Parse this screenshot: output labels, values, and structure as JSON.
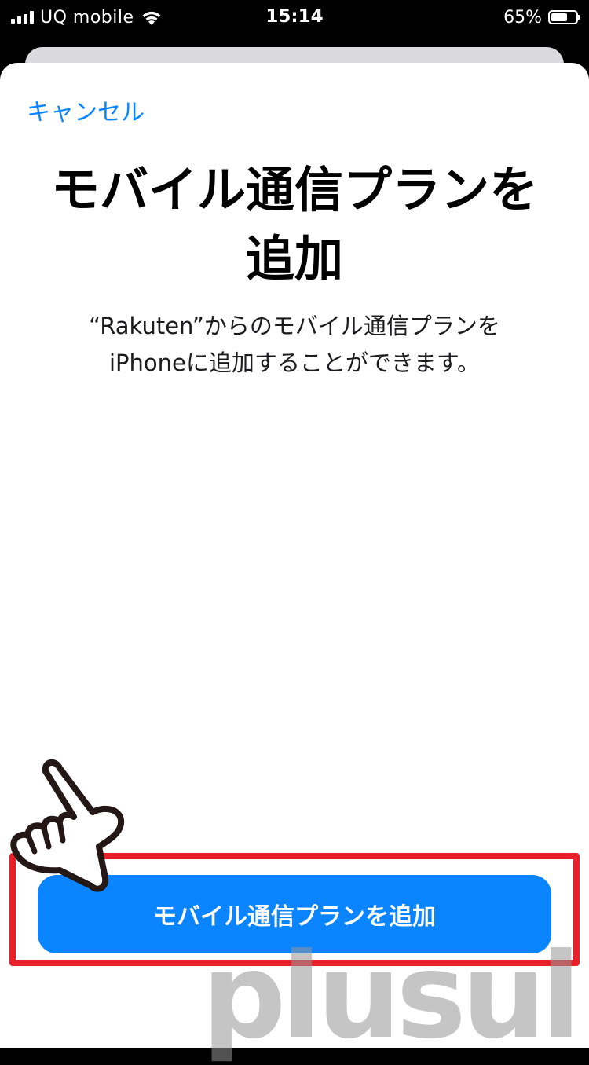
{
  "status_bar": {
    "carrier": "UQ mobile",
    "time": "15:14",
    "battery_percent": "65%",
    "battery_level": 0.65
  },
  "sheet": {
    "cancel_label": "キャンセル",
    "title": "モバイル通信プランを追加",
    "description_line1": "“Rakuten”からのモバイル通信プランを",
    "description_line2": "iPhoneに追加することができます。",
    "add_button_label": "モバイル通信プランを追加"
  },
  "watermark": {
    "text": "plusul"
  },
  "colors": {
    "accent_blue": "#0a84ff",
    "highlight_red": "#e8202a",
    "status_bar_bg": "#000000",
    "sheet_bg": "#ffffff"
  },
  "icons": {
    "signal": "cellular-signal-icon",
    "wifi": "wifi-icon",
    "battery": "battery-icon",
    "pointer": "pointing-hand-icon"
  }
}
